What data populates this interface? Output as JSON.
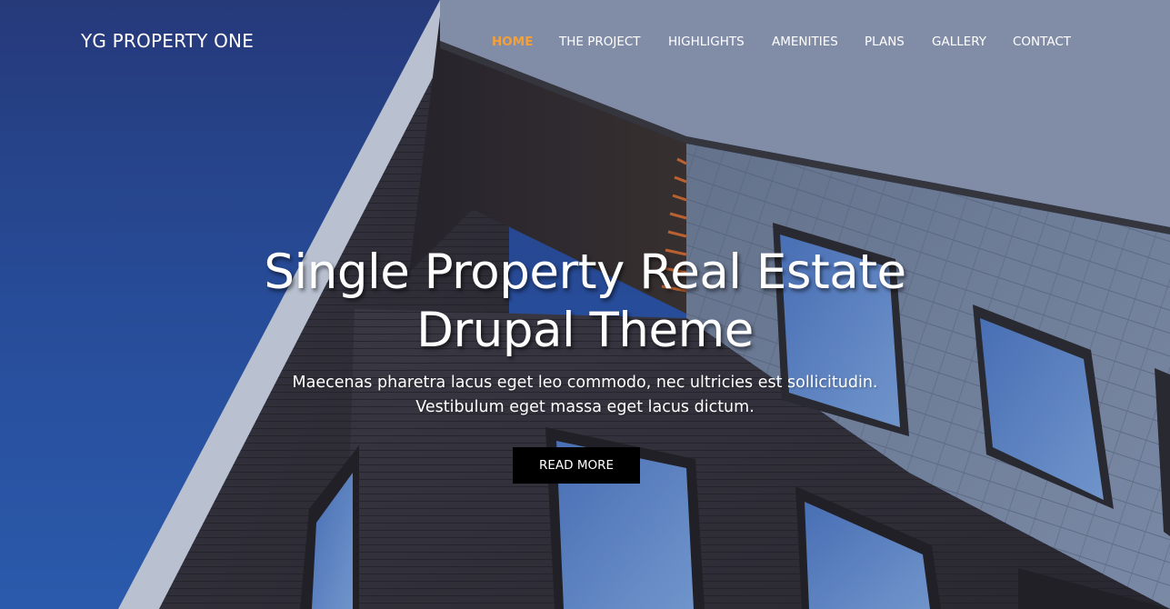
{
  "site": {
    "logo": "YG PROPERTY ONE"
  },
  "nav": {
    "items": [
      {
        "label": "HOME",
        "active": true
      },
      {
        "label": "THE PROJECT",
        "active": false
      },
      {
        "label": "HIGHLIGHTS",
        "active": false
      },
      {
        "label": "AMENITIES",
        "active": false
      },
      {
        "label": "PLANS",
        "active": false
      },
      {
        "label": "GALLERY",
        "active": false
      },
      {
        "label": "CONTACT",
        "active": false
      }
    ]
  },
  "hero": {
    "title": "Single Property Real Estate Drupal Theme",
    "subtitle": "Maecenas pharetra lacus eget leo commodo, nec ultricies est sollicitudin. Vestibulum eget massa eget lacus dictum.",
    "button_label": "READ MORE"
  },
  "colors": {
    "sky": "#2a56a8",
    "nav_active": "#f3a03b",
    "button_bg": "#000000",
    "text": "#ffffff"
  }
}
